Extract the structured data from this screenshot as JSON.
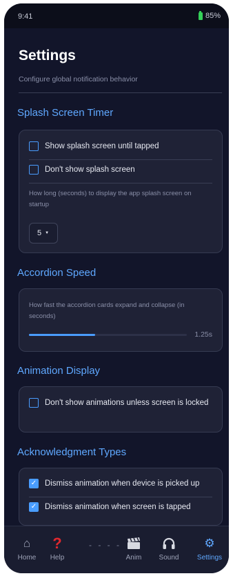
{
  "status_bar": {
    "time": "9:41",
    "battery": "85%"
  },
  "page": {
    "title": "Settings",
    "subtitle": "Configure global notification behavior"
  },
  "sections": {
    "splash": {
      "title": "Splash Screen Timer",
      "options": [
        {
          "label": "Show splash screen until tapped",
          "checked": false
        },
        {
          "label": "Don't show splash screen",
          "checked": false
        }
      ],
      "help": "How long (seconds) to display the app splash screen on startup",
      "select_value": "5"
    },
    "accordion": {
      "title": "Accordion Speed",
      "help": "How fast the accordion cards expand and collapse (in seconds)",
      "value_label": "1.25s",
      "fill_fraction": 0.42
    },
    "animation": {
      "title": "Animation Display",
      "options": [
        {
          "label": "Don't show animations unless screen is locked",
          "checked": false
        }
      ]
    },
    "acknowledgment": {
      "title": "Acknowledgment Types",
      "options": [
        {
          "label": "Dismiss animation when device is picked up",
          "checked": true
        },
        {
          "label": "Dismiss animation when screen is tapped",
          "checked": true
        }
      ]
    }
  },
  "nav": {
    "items": [
      {
        "label": "Home",
        "icon": "home-icon"
      },
      {
        "label": "Help",
        "icon": "help-icon"
      },
      {
        "label": "Anim",
        "icon": "clapperboard-icon"
      },
      {
        "label": "Sound",
        "icon": "headphones-icon"
      },
      {
        "label": "Settings",
        "icon": "gear-icon",
        "active": true
      }
    ],
    "dots": "- - - -"
  },
  "colors": {
    "accent": "#4a9dff",
    "section_title": "#5fa8ff",
    "background": "#12152a",
    "card": "#1f2236",
    "help_icon": "#e0282e",
    "battery": "#34d058"
  }
}
